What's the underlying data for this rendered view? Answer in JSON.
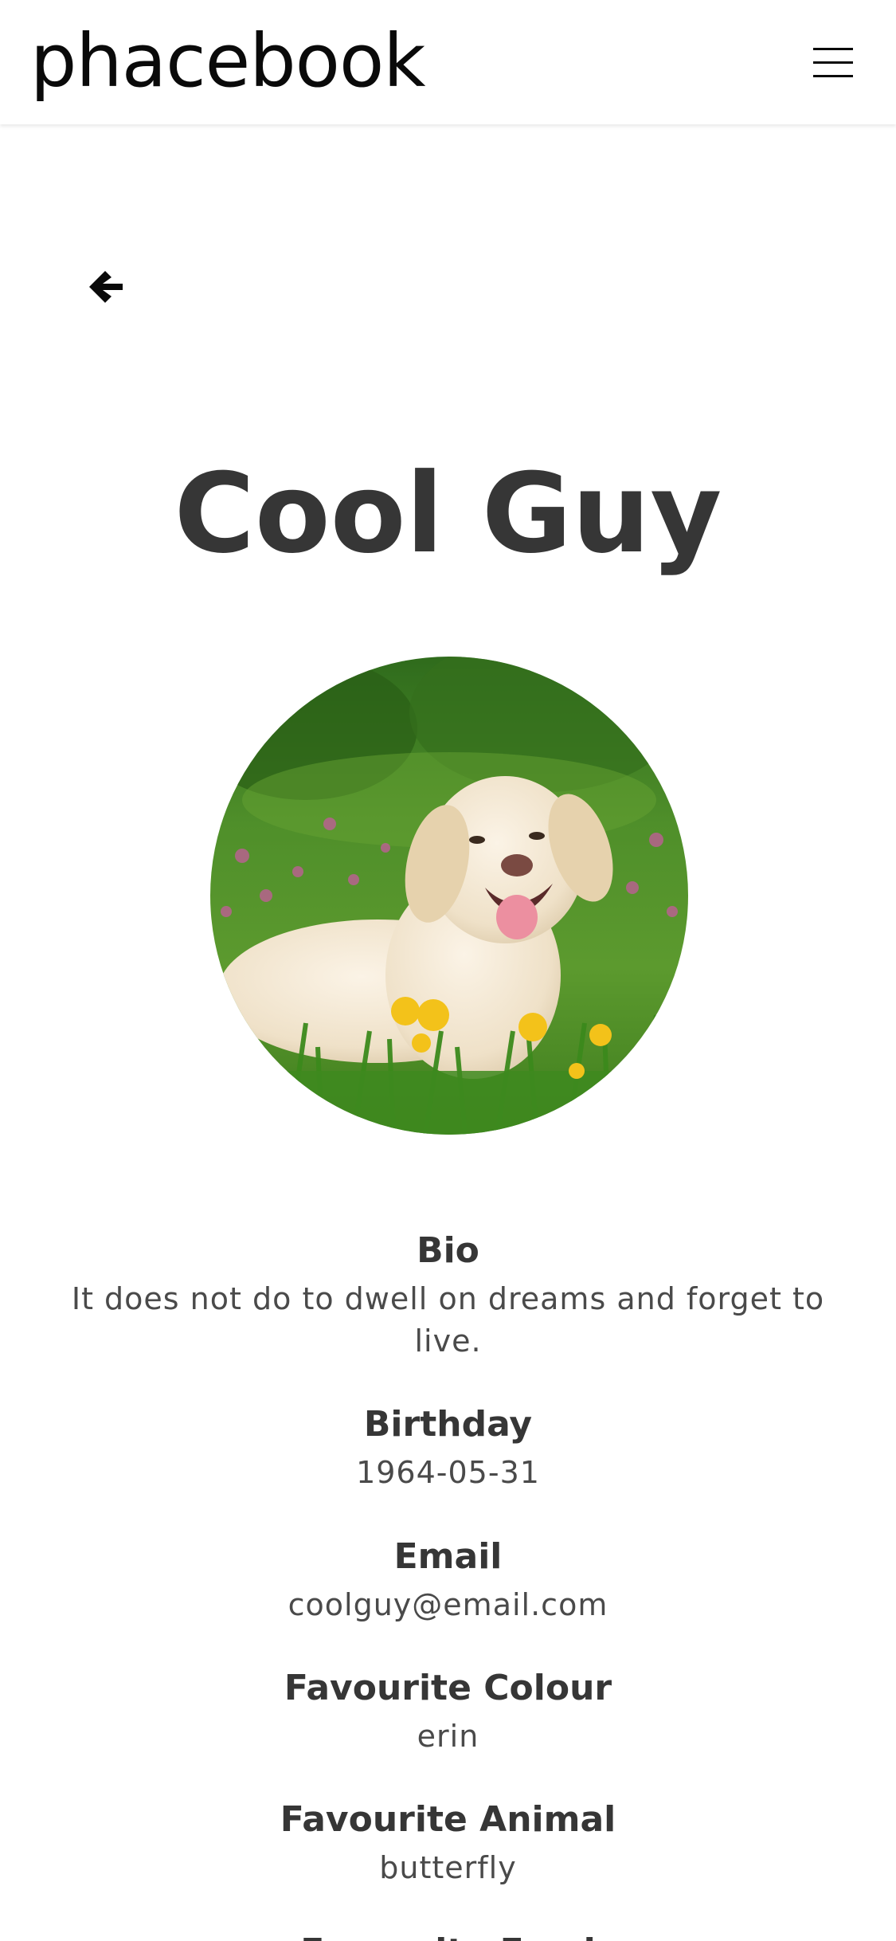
{
  "navbar": {
    "brand": "phacebook",
    "menu_icon": "hamburger-menu-icon"
  },
  "back_icon": "arrow-left-icon",
  "profile": {
    "name": "Cool Guy",
    "avatar_description": "golden retriever lying in grass with flowers",
    "fields": [
      {
        "label": "Bio",
        "value": "It does not do to dwell on dreams and forget to live."
      },
      {
        "label": "Birthday",
        "value": "1964-05-31"
      },
      {
        "label": "Email",
        "value": "coolguy@email.com"
      },
      {
        "label": "Favourite Colour",
        "value": "erin"
      },
      {
        "label": "Favourite Animal",
        "value": "butterfly"
      },
      {
        "label": "Favourite Food",
        "value": ""
      }
    ]
  }
}
